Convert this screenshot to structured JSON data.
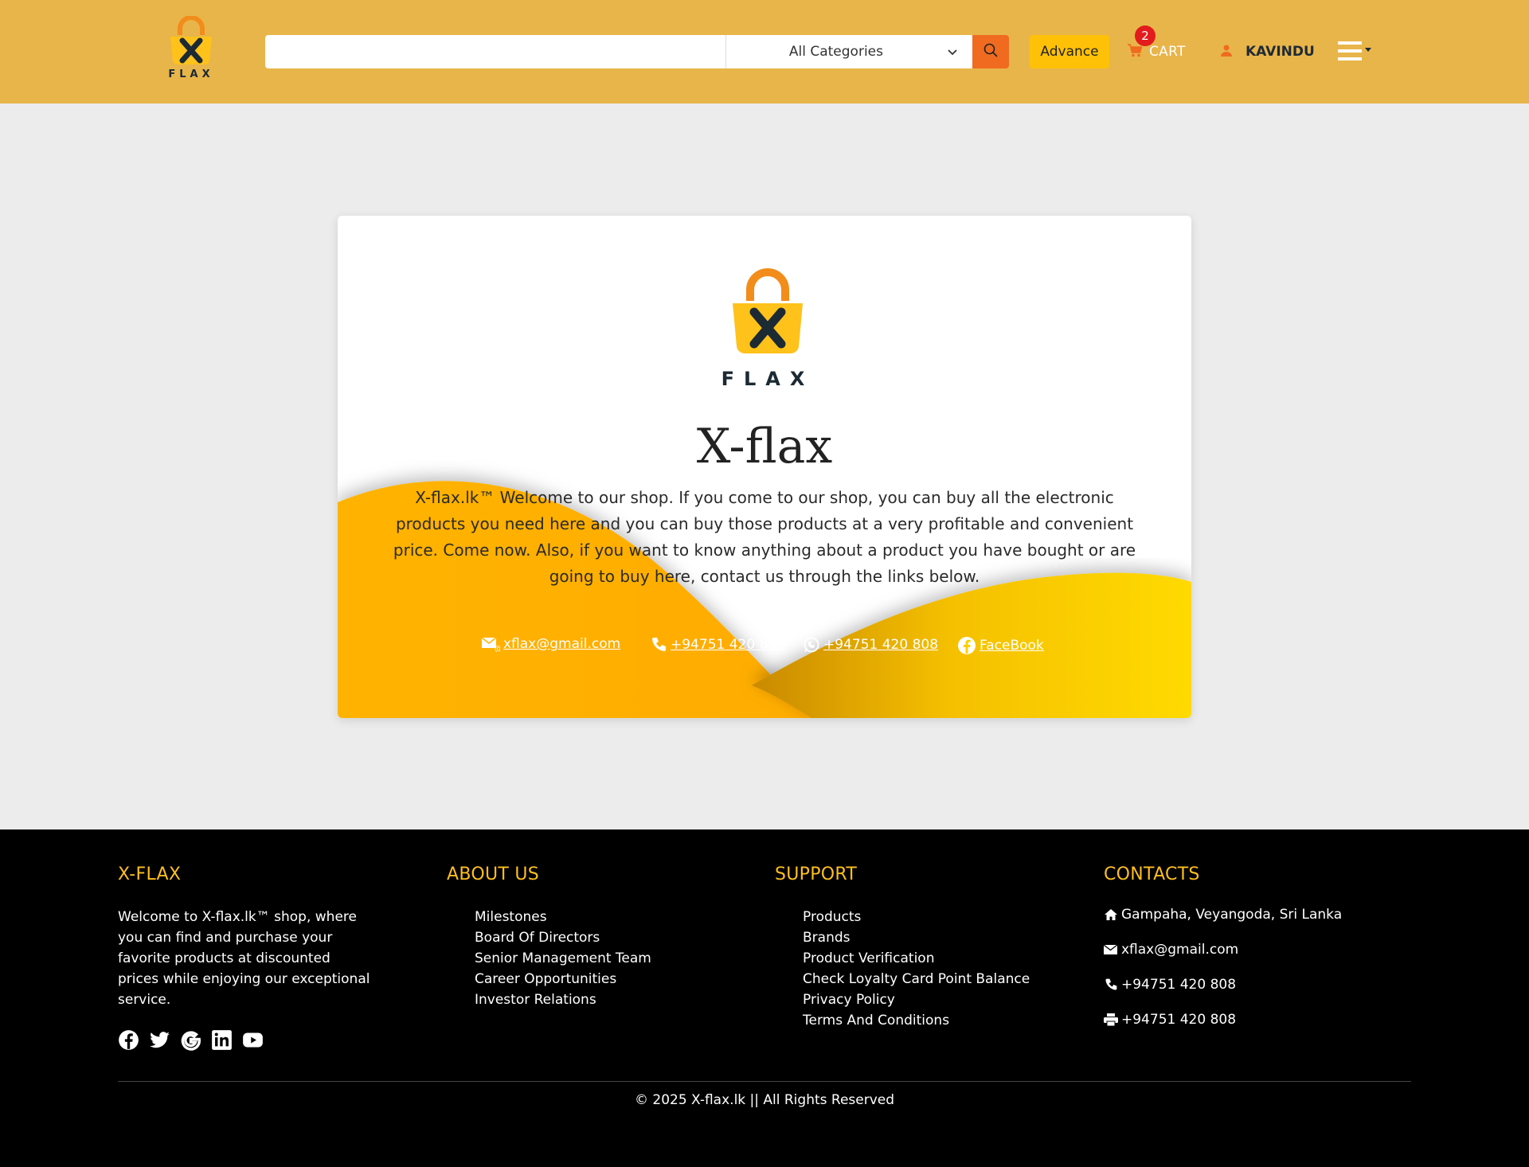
{
  "header": {
    "logo_text": "FLAX",
    "search": {
      "value": "",
      "placeholder": ""
    },
    "category_select": {
      "selected": "All Categories"
    },
    "advance_label": "Advance",
    "cart": {
      "label": "CART",
      "count": "2"
    },
    "user": {
      "name": "KAVINDU"
    },
    "colors": {
      "bar": "#e8b54a",
      "search_button": "#f06b1f",
      "advance": "#ffc107",
      "badge": "#e21c1c"
    }
  },
  "card": {
    "logo_text": "FLAX",
    "title": "X-flax",
    "text": "X-flax.lk™ Welcome to our shop. If you come to our shop, you can buy all the electronic products you need here and you can buy those products at a very profitable and convenient price. Come now. Also, if you want to know anything about a product you have bought or are going to buy here, contact us through the links below.",
    "links": {
      "email": "xflax@gmail.com",
      "phone": "+94751 420 808",
      "whatsapp": "+94751 420 808",
      "facebook": "FaceBook"
    }
  },
  "footer": {
    "brand": {
      "title": "X-FLAX",
      "text": "Welcome to X-flax.lk™ shop, where you can find and purchase your favorite products at discounted prices while enjoying our exceptional service."
    },
    "about": {
      "title": "ABOUT US",
      "items": [
        "Milestones",
        "Board Of Directors",
        "Senior Management Team",
        "Career Opportunities",
        "Investor Relations"
      ]
    },
    "support": {
      "title": "SUPPORT",
      "items": [
        "Products",
        "Brands",
        "Product Verification",
        "Check Loyalty Card Point Balance",
        "Privacy Policy",
        "Terms And Conditions"
      ]
    },
    "contacts": {
      "title": "CONTACTS",
      "address": "Gampaha, Veyangoda, Sri Lanka",
      "email": "xflax@gmail.com",
      "phone": "+94751 420 808",
      "fax": "+94751 420 808"
    },
    "copyright": "© 2025 X-flax.lk || All Rights Reserved",
    "accent": "#ffbf1f"
  }
}
